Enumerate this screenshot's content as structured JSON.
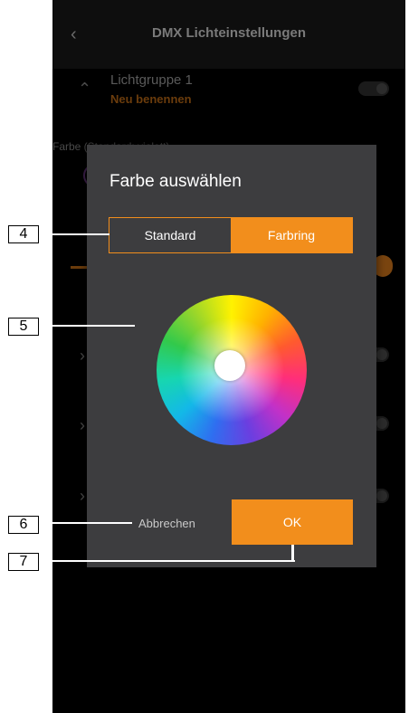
{
  "app": {
    "title": "DMX Lichteinstellungen",
    "back_icon": "chevron-left-icon"
  },
  "background": {
    "group_name": "Lichtgruppe 1",
    "rename_link": "Neu benennen",
    "color_label": "Farbe (Standard: violett)"
  },
  "dialog": {
    "title": "Farbe auswählen",
    "tabs": [
      {
        "label": "Standard",
        "selected": false
      },
      {
        "label": "Farbring",
        "selected": true
      }
    ],
    "cancel_label": "Abbrechen",
    "ok_label": "OK",
    "accent_color": "#f28e1c"
  },
  "callouts": [
    "4",
    "5",
    "6",
    "7"
  ]
}
